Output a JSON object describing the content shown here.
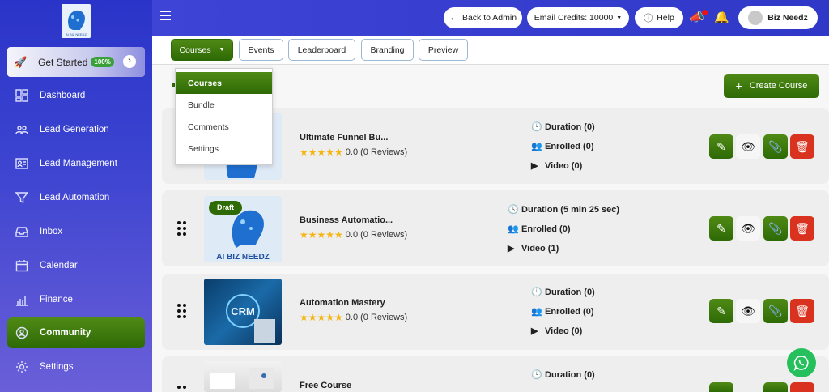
{
  "sidebar": {
    "logo_text": "AI BIZ NEEDZ",
    "get_started": {
      "label": "Get Started",
      "badge": "100%"
    },
    "items": [
      {
        "label": "Dashboard",
        "icon": "dashboard-icon"
      },
      {
        "label": "Lead Generation",
        "icon": "users-icon"
      },
      {
        "label": "Lead Management",
        "icon": "id-card-icon"
      },
      {
        "label": "Lead Automation",
        "icon": "funnel-icon"
      },
      {
        "label": "Inbox",
        "icon": "inbox-icon"
      },
      {
        "label": "Calendar",
        "icon": "calendar-icon"
      },
      {
        "label": "Finance",
        "icon": "bar-chart-icon"
      },
      {
        "label": "Community",
        "icon": "community-icon",
        "active": true
      },
      {
        "label": "Settings",
        "icon": "gear-icon"
      }
    ]
  },
  "topbar": {
    "back_label": "Back to Admin",
    "credits_label": "Email Credits: 10000",
    "help_label": "Help",
    "user_name": "Biz Needz"
  },
  "tabs": [
    {
      "label": "Courses",
      "active": true
    },
    {
      "label": "Events"
    },
    {
      "label": "Leaderboard"
    },
    {
      "label": "Branding"
    },
    {
      "label": "Preview"
    }
  ],
  "dropdown": [
    "Courses",
    "Bundle",
    "Comments",
    "Settings"
  ],
  "create_label": "Create Course",
  "courses": [
    {
      "title": "Ultimate Funnel Bu...",
      "rating": "0.0 (0 Reviews)",
      "duration": "Duration (0)",
      "enrolled": "Enrolled (0)",
      "video": "Video (0)"
    },
    {
      "title": "Business Automatio...",
      "rating": "0.0 (0 Reviews)",
      "duration": "Duration (5 min 25 sec)",
      "enrolled": "Enrolled (0)",
      "video": "Video (1)",
      "badge": "Draft",
      "thumb_text": "AI BIZ NEEDZ"
    },
    {
      "title": "Automation Mastery",
      "rating": "0.0 (0 Reviews)",
      "duration": "Duration (0)",
      "enrolled": "Enrolled (0)",
      "video": "Video (0)",
      "thumb_text": "CRM"
    },
    {
      "title": "Free Course",
      "duration": "Duration (0)"
    }
  ],
  "colors": {
    "brand_green": "#2e6a05",
    "sidebar_blue": "#2a34c8",
    "delete_red": "#d9331f",
    "star": "#f6b40d"
  }
}
